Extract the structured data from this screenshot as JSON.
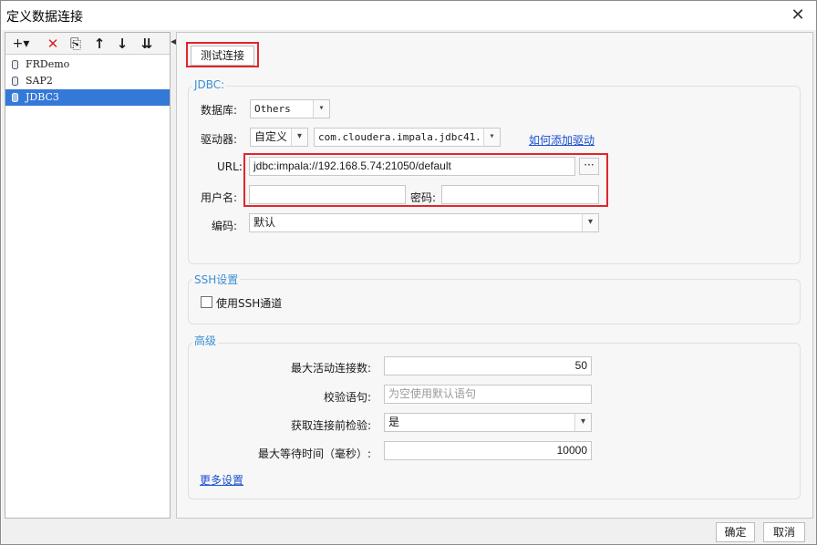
{
  "window": {
    "title": "定义数据连接",
    "close_glyph": "✕"
  },
  "toolbar": {
    "add": "+▾",
    "delete": "✕",
    "copy": "⎘",
    "up": "↑",
    "down": "↓",
    "sort": "⇊"
  },
  "connections": [
    {
      "name": "FRDemo",
      "selected": false
    },
    {
      "name": "SAP2",
      "selected": false
    },
    {
      "name": "JDBC3",
      "selected": true
    }
  ],
  "actions": {
    "test_connection": "测试连接",
    "ok": "确定",
    "cancel": "取消"
  },
  "jdbc": {
    "group_label": "JDBC:",
    "database_label": "数据库:",
    "database_value": "Others",
    "driver_label": "驱动器:",
    "driver_mode": "自定义",
    "driver_class": "com.cloudera.impala.jdbc41...",
    "add_driver_link": "如何添加驱动",
    "url_label": "URL:",
    "url_value": "jdbc:impala://192.168.5.74:21050/default",
    "url_button": "···",
    "username_label": "用户名:",
    "username_value": "",
    "password_label": "密码:",
    "password_value": "",
    "encoding_label": "编码:",
    "encoding_value": "默认"
  },
  "ssh": {
    "group_label": "SSH设置",
    "use_ssh_label": "使用SSH通道",
    "use_ssh_checked": false
  },
  "advanced": {
    "group_label": "高级",
    "max_active_label": "最大活动连接数:",
    "max_active_value": "50",
    "validation_query_label": "校验语句:",
    "validation_query_placeholder": "为空使用默认语句",
    "test_before_get_label": "获取连接前检验:",
    "test_before_get_value": "是",
    "max_wait_label": "最大等待时间（毫秒）:",
    "max_wait_value": "10000",
    "more_settings_link": "更多设置"
  },
  "colors": {
    "accent_label": "#3a8fd6",
    "selection": "#3478d8",
    "highlight_box": "#e0262c",
    "link": "#1a4fd0"
  }
}
